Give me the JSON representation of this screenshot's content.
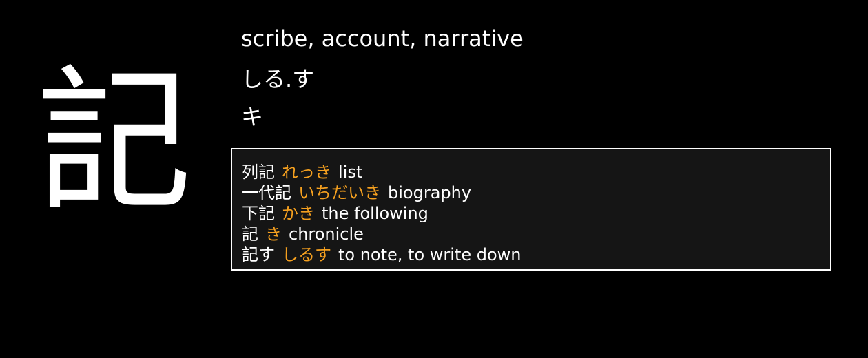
{
  "kanji": "記",
  "meanings": "scribe, account, narrative",
  "kun_reading": "しる.す",
  "on_reading": "キ",
  "colors": {
    "background": "#000000",
    "text": "#ffffff",
    "reading_accent": "#f5a01f",
    "panel_background": "#151515",
    "panel_border": "#ffffff"
  },
  "examples": [
    {
      "word": "列記",
      "reading": "れっき",
      "gloss": "list"
    },
    {
      "word": "一代記",
      "reading": "いちだいき",
      "gloss": "biography"
    },
    {
      "word": "下記",
      "reading": "かき",
      "gloss": "the following"
    },
    {
      "word": "記",
      "reading": "き",
      "gloss": "chronicle"
    },
    {
      "word": "記す",
      "reading": "しるす",
      "gloss": "to note, to write down"
    }
  ]
}
